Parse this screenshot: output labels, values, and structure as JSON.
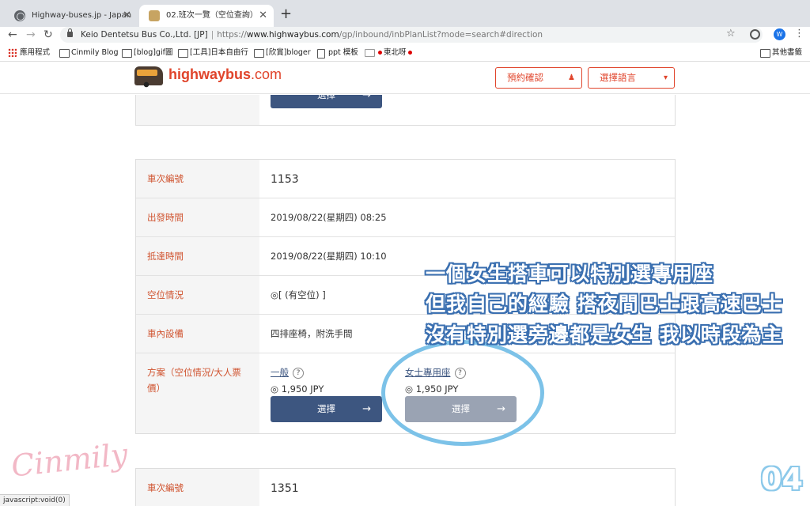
{
  "browser": {
    "tabs": [
      {
        "title": "Highway-buses.jp - Japan"
      },
      {
        "title": "02.班次一覽（空位查詢）"
      }
    ],
    "new_tab": "+",
    "close": "✕",
    "address": {
      "site_name": "Keio Dentetsu Bus Co.,Ltd. [JP]",
      "url_scheme": "https://",
      "url_host": "www.highwaybus.com",
      "url_path": "/gp/inbound/inbPlanList?mode=search#direction"
    },
    "avatar_letter": "W",
    "bookmarks": [
      {
        "label": "應用程式"
      },
      {
        "label": "Cinmily Blog"
      },
      {
        "label": "[blog]gif圖"
      },
      {
        "label": "[工具]日本自由行"
      },
      {
        "label": "[欣賞]bloger"
      },
      {
        "label": "ppt 模板"
      },
      {
        "label": "東北呀"
      }
    ],
    "other_bookmarks": "其他書籤",
    "status_url": "javascript:void(0)"
  },
  "site": {
    "logo_main": "highwaybus",
    "logo_domain": ".com",
    "reservation_button": "預約確認",
    "language_button": "選擇語言",
    "colors": {
      "accent": "#e0442b",
      "button": "#3d5680"
    }
  },
  "results": {
    "select_label": "選擇",
    "card1": {
      "bus_no_label": "車次編號",
      "bus_no": "1153",
      "depart_label": "出發時間",
      "depart": "2019/08/22(星期四) 08:25",
      "arrive_label": "抵達時間",
      "arrive": "2019/08/22(星期四) 10:10",
      "seats_label": "空位情況",
      "seats": "◎[ (有空位) ]",
      "facilities_label": "車內設備",
      "facilities": "四排座椅，附洗手間",
      "plans_label_line1": "方案（空位情況/大人票",
      "plans_label_line2": "價）",
      "plans": [
        {
          "name": "一般",
          "price": "◎ 1,950 JPY",
          "enabled": true
        },
        {
          "name": "女士專用座",
          "price": "◎ 1,950 JPY",
          "enabled": false
        }
      ]
    },
    "card2": {
      "bus_no_label": "車次編號",
      "bus_no": "1351"
    }
  },
  "annotation": {
    "lines": [
      "一個女生搭車可以特別選專用座",
      "但我自己的經驗 搭夜間巴士跟高速巴士",
      "沒有特別選旁邊都是女生 我以時段為主"
    ],
    "signature": "Cinmily",
    "page_number": "04"
  }
}
